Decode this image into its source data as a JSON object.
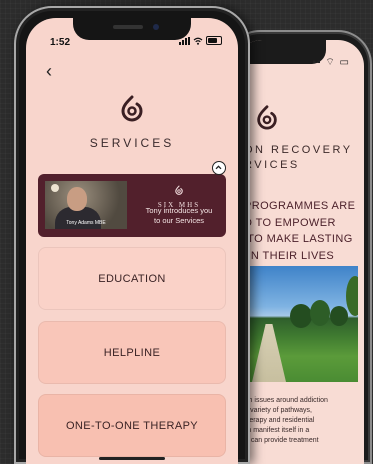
{
  "back_screen": {
    "title": "ON RECOVERY\nRVICES",
    "heading": "PROGRAMMES ARE\nD TO EMPOWER\n TO MAKE LASTING\n IN THEIR LIVES",
    "paragraph": "with issues around addiction\nr a variety of pathways,\nl therapy and residential\ncan manifest itself in a\nwe can provide treatment"
  },
  "status_bar": {
    "time": "1:52"
  },
  "nav": {
    "back_icon": "‹"
  },
  "page": {
    "title": "SERVICES"
  },
  "video_card": {
    "thumbnail_caption": "Tony Adams MBE",
    "brand": "SIX MHS",
    "text": "Tony introduces you\nto our Services"
  },
  "services": [
    {
      "label": "EDUCATION"
    },
    {
      "label": "HELPLINE"
    },
    {
      "label": "ONE-TO-ONE THERAPY"
    }
  ],
  "colors": {
    "screen_bg": "#f8d5cc",
    "card_bg": "#52202c",
    "text_dark": "#3a2b2d"
  }
}
